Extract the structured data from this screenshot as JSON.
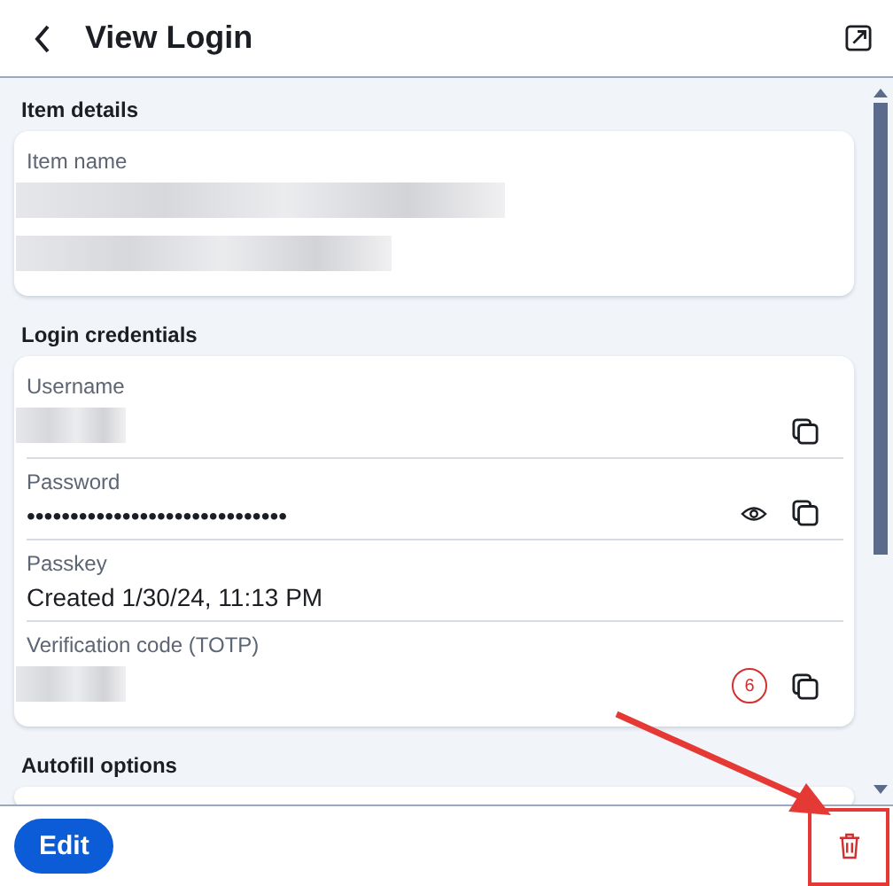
{
  "header": {
    "title": "View Login"
  },
  "sections": [
    {
      "title": "Item details",
      "fields": [
        {
          "label": "Item name",
          "kind": "redacted-long",
          "copyable": false,
          "revealable": false
        }
      ]
    },
    {
      "title": "Login credentials",
      "fields": [
        {
          "label": "Username",
          "kind": "redacted",
          "copyable": true,
          "revealable": false
        },
        {
          "label": "Password",
          "kind": "text",
          "value": "••••••••••••••••••••••••••••••",
          "copyable": true,
          "revealable": true
        },
        {
          "label": "Passkey",
          "kind": "text",
          "value": "Created 1/30/24, 11:13 PM",
          "copyable": false,
          "revealable": false
        },
        {
          "label": "Verification code (TOTP)",
          "kind": "redacted",
          "timer": "6",
          "copyable": true,
          "revealable": false
        }
      ]
    },
    {
      "title": "Autofill options"
    }
  ],
  "footer": {
    "primary": "Edit"
  }
}
